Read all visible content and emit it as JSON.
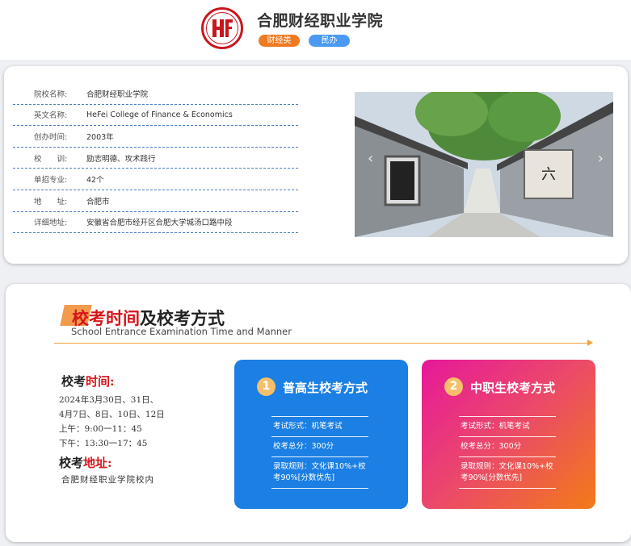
{
  "header": {
    "school_name": "合肥财经职业学院",
    "tags": [
      "财经类",
      "民办"
    ]
  },
  "info": {
    "rows": [
      {
        "label": "院校名称:",
        "value": "合肥财经职业学院"
      },
      {
        "label": "英文名称:",
        "value": "HeFei College of Finance & Economics"
      },
      {
        "label": "创办时间:",
        "value": "2003年"
      },
      {
        "label": "校　　训:",
        "value": "励志明德、攻术践行"
      },
      {
        "label": "单招专业:",
        "value": "42个"
      },
      {
        "label": "地　　址:",
        "value": "合肥市"
      },
      {
        "label": "详细地址:",
        "value": "安徽省合肥市经开区合肥大学城汤口路中段"
      }
    ],
    "photo_icon": "campus-alley-photo",
    "arrow_left": "‹",
    "arrow_right": "›"
  },
  "exam": {
    "title_highlight": "校考时间",
    "title_rest": "及校考方式",
    "subtitle": "School Entrance Examination Time and Manner",
    "time_heading_a": "校考",
    "time_heading_b": "时间:",
    "time_lines": [
      "2024年3月30日、31日、",
      "4月7日、8日、10日、12日",
      "上午：9:00一11：45",
      "下午：13:30一17：45"
    ],
    "place_heading_a": "校考",
    "place_heading_b": "地址:",
    "place_text": "合肥财经职业学院校内",
    "modes": [
      {
        "badge": "1",
        "title": "普高生校考方式",
        "items": [
          "考试形式：机笔考试",
          "校考总分：300分",
          "录取规则：文化课10%+校考90%[分数优先]"
        ]
      },
      {
        "badge": "2",
        "title": "中职生校考方式",
        "items": [
          "考试形式：机笔考试",
          "校考总分：300分",
          "录取规则：文化课10%+校考90%[分数优先]"
        ]
      }
    ],
    "colors": {
      "accent_red": "#d4161b",
      "blue_card": "#1b7fe3",
      "orange": "#f07a22"
    }
  }
}
